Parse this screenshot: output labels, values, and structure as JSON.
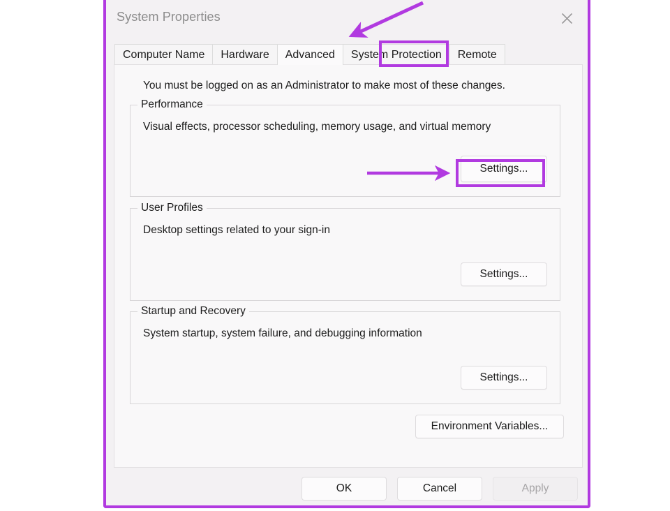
{
  "window": {
    "title": "System Properties",
    "close_icon": "close-icon"
  },
  "tabs": [
    {
      "label": "Computer Name",
      "selected": false
    },
    {
      "label": "Hardware",
      "selected": false
    },
    {
      "label": "Advanced",
      "selected": true
    },
    {
      "label": "System Protection",
      "selected": false
    },
    {
      "label": "Remote",
      "selected": false
    }
  ],
  "content": {
    "admin_note": "You must be logged on as an Administrator to make most of these changes.",
    "groups": [
      {
        "legend": "Performance",
        "description": "Visual effects, processor scheduling, memory usage, and virtual memory",
        "button_label": "Settings..."
      },
      {
        "legend": "User Profiles",
        "description": "Desktop settings related to your sign-in",
        "button_label": "Settings..."
      },
      {
        "legend": "Startup and Recovery",
        "description": "System startup, system failure, and debugging information",
        "button_label": "Settings..."
      }
    ],
    "environment_variables_label": "Environment Variables..."
  },
  "footer": {
    "ok_label": "OK",
    "cancel_label": "Cancel",
    "apply_label": "Apply",
    "apply_disabled": true
  },
  "annotations": {
    "highlight_color": "#b13ae0",
    "arrow_to_tab": "arrow-pointing-to-advanced-tab",
    "arrow_to_settings": "arrow-pointing-to-performance-settings"
  }
}
